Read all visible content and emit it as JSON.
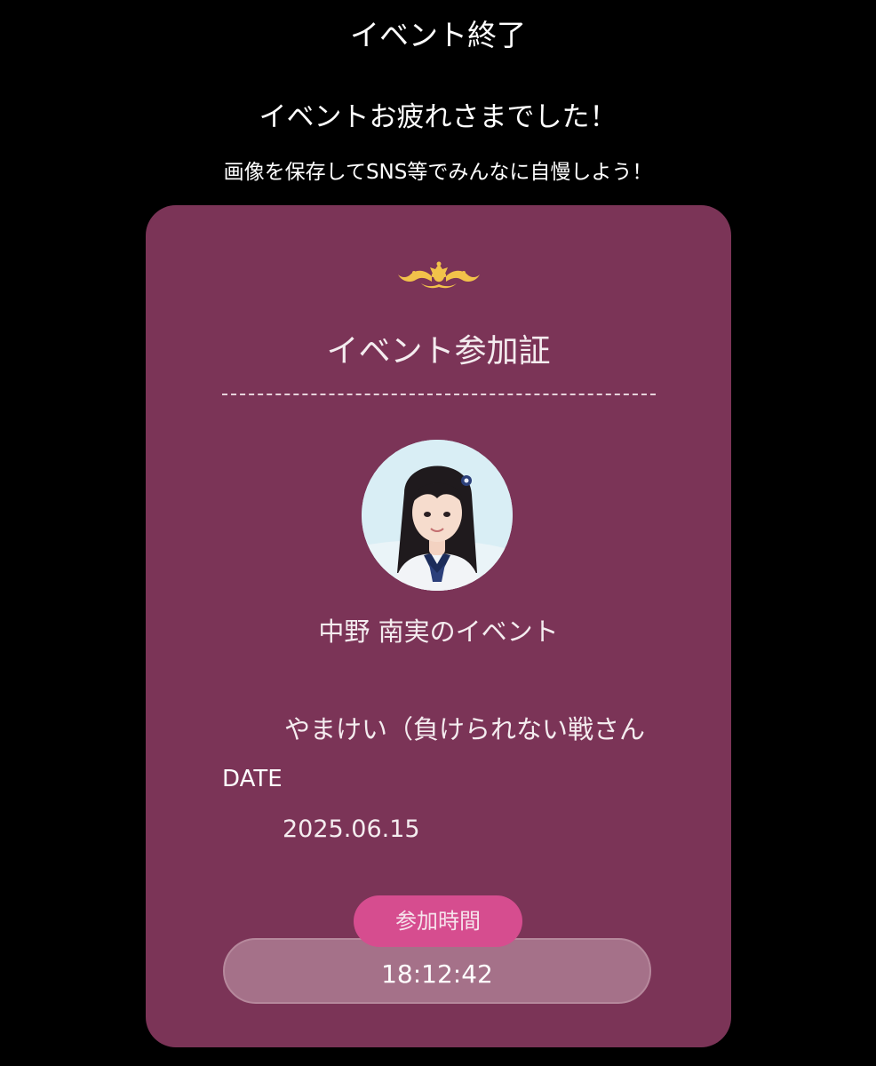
{
  "header": {
    "title": "イベント終了"
  },
  "message": {
    "title": "イベントお疲れさまでした！",
    "hint": "画像を保存してSNS等でみんなに自慢しよう！"
  },
  "card": {
    "title": "イベント参加証",
    "ornament_icon": "crown-ornament-icon",
    "ornament_color": "#f2c24a",
    "owner": "中野 南実のイベント",
    "participant": "やまけい（負けられない戦さん",
    "date_label": "DATE",
    "date_value": "2025.06.15",
    "time_label": "参加時間",
    "time_value": "18:12:42",
    "background_color": "#7b3457",
    "badge_color": "#d64d8f"
  }
}
